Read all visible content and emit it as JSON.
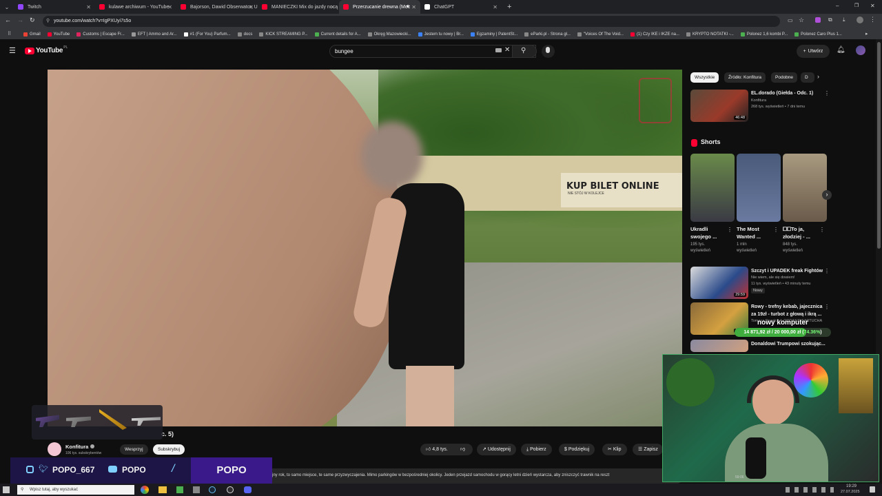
{
  "tabs": [
    {
      "label": "Twitch",
      "color": "#9146ff",
      "active": false
    },
    {
      "label": "kulawe archiwum - YouTube",
      "color": "#ff0033",
      "active": false
    },
    {
      "label": "Bajorson, Dawid Obserwator, U",
      "color": "#ff0033",
      "active": false
    },
    {
      "label": "MANIECZKI Mix do jazdy nocą",
      "color": "#ff0033",
      "active": false
    },
    {
      "label": "Przerzucanie drewna (Moc",
      "color": "#ff0033",
      "active": true
    },
    {
      "label": "ChatGPT",
      "color": "#ffffff",
      "active": false
    }
  ],
  "address": {
    "url": "youtube.com/watch?v=IgPXUyi7s5o"
  },
  "bookmarks": [
    {
      "label": "Gmail",
      "color": "#ea4335"
    },
    {
      "label": "YouTube",
      "color": "#ff0033"
    },
    {
      "label": "Customs | Escape Fr...",
      "color": "#e0245e"
    },
    {
      "label": "EFT | Ammo and Ar...",
      "color": "#999999"
    },
    {
      "label": "#1 (For You) Parfum...",
      "color": "#ffffff"
    },
    {
      "label": "docs",
      "color": "#888888"
    },
    {
      "label": "KICK STREAMING P...",
      "color": "#888888"
    },
    {
      "label": "Current details for A...",
      "color": "#4caf50"
    },
    {
      "label": "Okręg Mazowiecki...",
      "color": "#888888"
    },
    {
      "label": "Jestem tu nowy | Br...",
      "color": "#3b82f6"
    },
    {
      "label": "Egzaminy | PatentSt...",
      "color": "#3b82f6"
    },
    {
      "label": "eParki.pl - Strona gł...",
      "color": "#888888"
    },
    {
      "label": "\"Voices Of The Void...",
      "color": "#888888"
    },
    {
      "label": "(1) Czy IKE i IKZE na...",
      "color": "#ff0033"
    },
    {
      "label": "KRYPTO NOTATKI -...",
      "color": "#888888"
    },
    {
      "label": "Polonez 1,6 kombi P...",
      "color": "#4caf50"
    },
    {
      "label": "Polonez Caro Plus 1...",
      "color": "#4caf50"
    }
  ],
  "yt": {
    "logo": "YouTube",
    "region": "PL",
    "search_value": "bungee",
    "create_label": "Utwórz"
  },
  "video": {
    "sign_text": "KUP BILET ONLINE",
    "sign_sub": "NIE STÓJ W KOLEJCE",
    "title_fragment": "c. 5)"
  },
  "channel": {
    "name": "Konfitura",
    "subs": "106 tys. subskrybentów",
    "support_label": "Wesprzyj",
    "subscribe_label": "Subskrybuj"
  },
  "actions": {
    "likes": "4,8 tys.",
    "share": "Udostępnij",
    "download": "Pobierz",
    "thanks": "Podziękuj",
    "clip": "Klip",
    "save": "Zapisz"
  },
  "description": "jny rok, to samo miejsce, te same przyzwyczajenia. Mimo parkingów w bezpośredniej okolicy. Jeden przejazd samochodu w gorący letni dzień wystarcza, aby zniszczyć trawnik na reszt",
  "chips": [
    "Wszystkie",
    "Źródło: Konfitura",
    "Podobne",
    "D"
  ],
  "rec_top": {
    "title": "EL.dorado (Giełda - Odc. 1)",
    "channel": "Konfitura",
    "meta": "268 tys. wyświetleń • 7 dni temu",
    "duration": "46:48"
  },
  "shorts_label": "Shorts",
  "shorts": [
    {
      "title1": "Ukradli",
      "title2": "swojego ...",
      "views1": "195 tys.",
      "views2": "wyświetleń"
    },
    {
      "title1": "The Most",
      "title2": "Wanted ...",
      "views1": "1 mln",
      "views2": "wyświetleń"
    },
    {
      "title1": "⧠⧠To ja,",
      "title2": "złodziej - ...",
      "views1": "848 tys.",
      "views2": "wyświetleń"
    }
  ],
  "recs": [
    {
      "title": "Szczyt i UPADEK freak Fightów",
      "channel": "Nie wiem, ale się dowiem!",
      "meta": "11 tys. wyświetleń • 43 minuty temu",
      "badge": "Nowy",
      "duration": "29:59"
    },
    {
      "title": "Rowy - trefny kebab, jajecznica",
      "title2": "za 19zł - turbot z głową i ikrą ...",
      "channel": "Tomasz Strzelczyk ODDASZYFARTUCHA",
      "meta": "",
      "badge": "",
      "duration": "19:13"
    },
    {
      "title": "Donaldowi Trumpowi szokując...",
      "channel": "",
      "meta": "",
      "badge": "",
      "duration": ""
    }
  ],
  "goal": {
    "label": "nowy komputer",
    "current": "14 871,92 zł",
    "target": "20 000,00 zł",
    "percent_text": "74.36%",
    "progress": 0.7436
  },
  "stream_social": {
    "handle1": "POPO_667",
    "handle2": "POPO",
    "brand": "POPO"
  },
  "cam": {
    "timer": "59:06"
  },
  "taskbar": {
    "search": "Wpisz tutaj, aby wyszukać",
    "time": "19:29",
    "date": "27.07.2025"
  }
}
